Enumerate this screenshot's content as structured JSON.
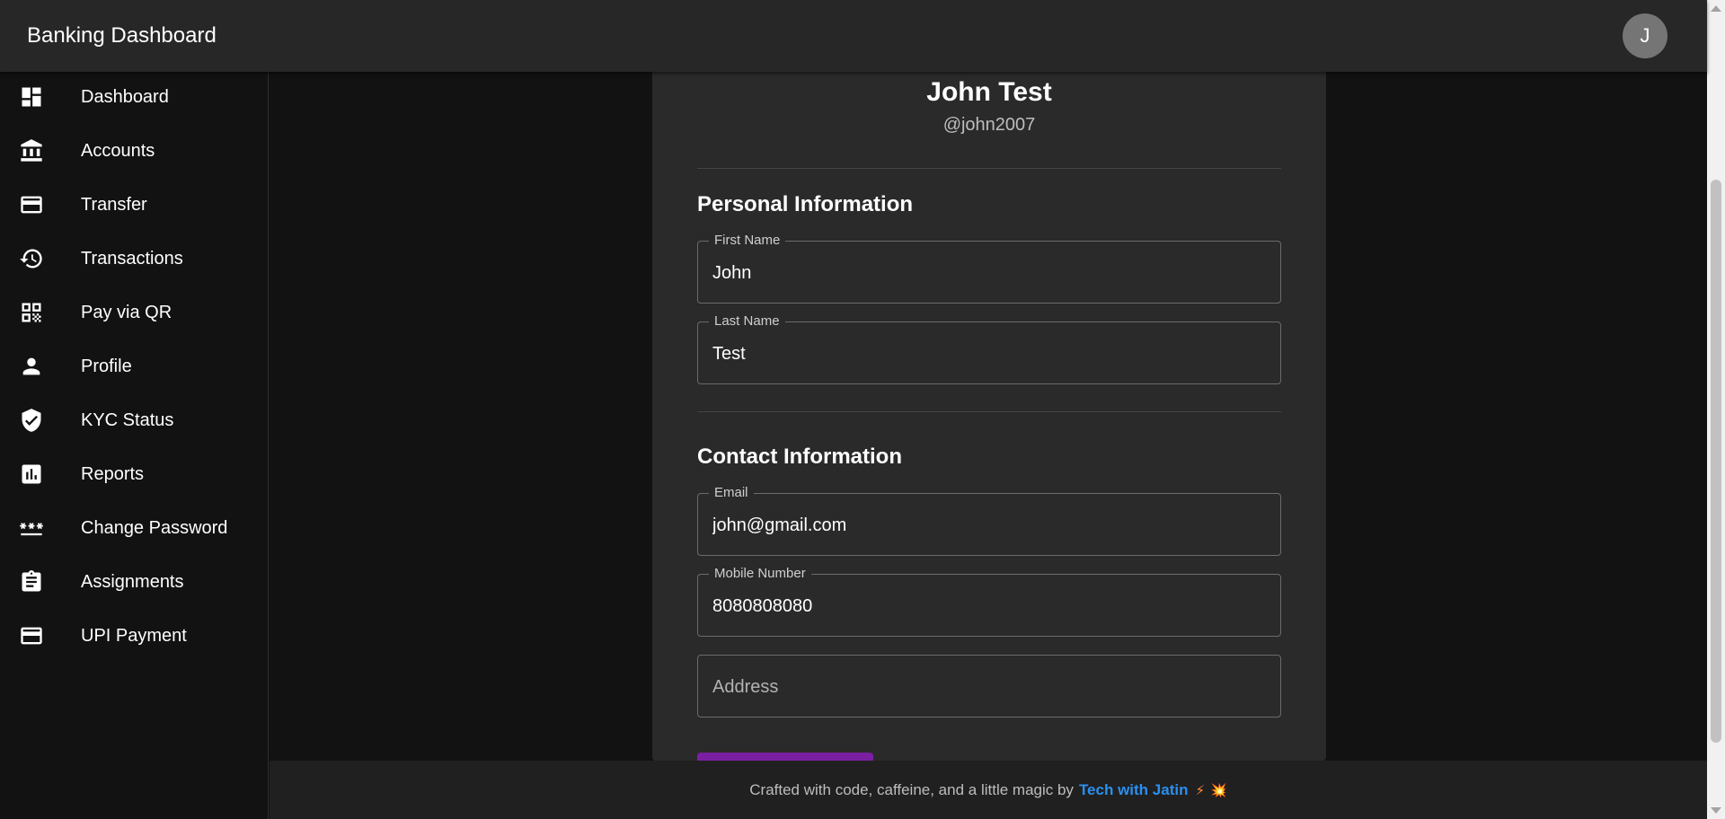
{
  "header": {
    "title": "Banking Dashboard",
    "avatar_initial": "J"
  },
  "sidebar": {
    "items": [
      {
        "label": "Dashboard",
        "icon": "dashboard-icon"
      },
      {
        "label": "Accounts",
        "icon": "bank-icon"
      },
      {
        "label": "Transfer",
        "icon": "credit-card-icon"
      },
      {
        "label": "Transactions",
        "icon": "history-icon"
      },
      {
        "label": "Pay via QR",
        "icon": "qr-code-icon"
      },
      {
        "label": "Profile",
        "icon": "person-icon"
      },
      {
        "label": "KYC Status",
        "icon": "verified-shield-icon"
      },
      {
        "label": "Reports",
        "icon": "bar-chart-icon"
      },
      {
        "label": "Change Password",
        "icon": "password-icon"
      },
      {
        "label": "Assignments",
        "icon": "clipboard-icon"
      },
      {
        "label": "UPI Payment",
        "icon": "credit-card-icon"
      }
    ]
  },
  "profile": {
    "name": "John Test",
    "username": "@john2007",
    "personal_section_title": "Personal Information",
    "first_name_label": "First Name",
    "first_name_value": "John",
    "last_name_label": "Last Name",
    "last_name_value": "Test",
    "contact_section_title": "Contact Information",
    "email_label": "Email",
    "email_value": "john@gmail.com",
    "mobile_label": "Mobile Number",
    "mobile_value": "8080808080",
    "address_placeholder": "Address"
  },
  "footer": {
    "text": "Crafted with code, caffeine, and a little magic by",
    "link_text": "Tech with Jatin",
    "emoji1": "⚡",
    "emoji2": "💥"
  },
  "colors": {
    "accent_button": "#7b1fa2",
    "footer_link": "#2b8ff0",
    "appbar": "#272727"
  }
}
